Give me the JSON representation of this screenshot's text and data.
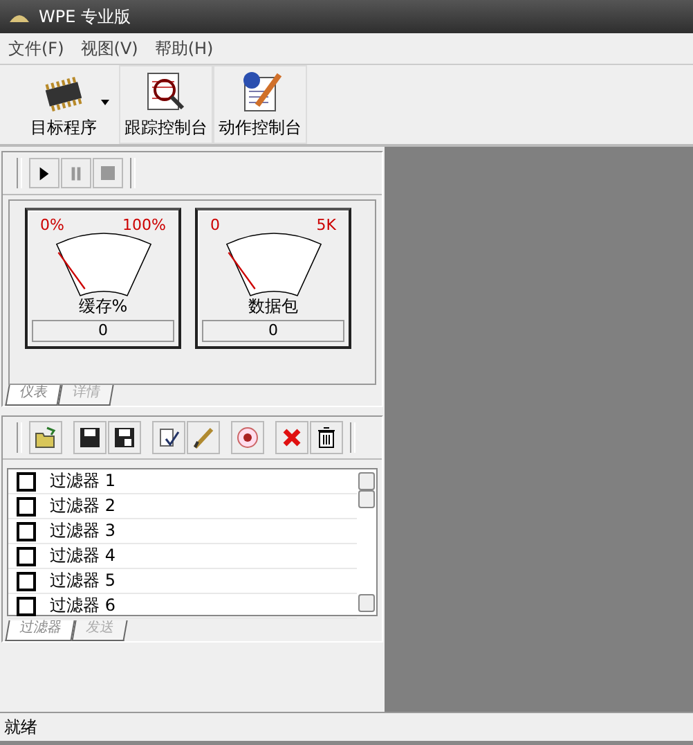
{
  "window": {
    "title": "WPE 专业版"
  },
  "menu": [
    "文件(F)",
    "视图(V)",
    "帮助(H)"
  ],
  "toolbar": [
    {
      "kind": "chip",
      "label": "目标程序",
      "dropdown": true
    },
    {
      "kind": "magnifier",
      "label": "跟踪控制台",
      "dropdown": false
    },
    {
      "kind": "pencil",
      "label": "动作控制台",
      "dropdown": false
    }
  ],
  "player": [
    {
      "kind": "play",
      "disabled": false
    },
    {
      "kind": "pause",
      "disabled": true
    },
    {
      "kind": "stop",
      "disabled": true
    }
  ],
  "gauges": [
    {
      "min": "0%",
      "max": "100%",
      "label": "缓存%",
      "value": "0",
      "level": 0
    },
    {
      "min": "0",
      "max": "5K",
      "label": "数据包",
      "value": "0",
      "level": 0
    }
  ],
  "gauge_tabs": [
    {
      "label": "仪表",
      "selected": true
    },
    {
      "label": "详情",
      "selected": false
    }
  ],
  "filter_tools": [
    {
      "kind": "open"
    },
    {
      "kind": "save"
    },
    {
      "kind": "save-as"
    },
    {
      "kind": "check"
    },
    {
      "kind": "pen"
    },
    {
      "kind": "on"
    },
    {
      "kind": "delete"
    },
    {
      "kind": "trash"
    }
  ],
  "filters": [
    {
      "label": "过滤器 1",
      "checked": false
    },
    {
      "label": "过滤器 2",
      "checked": false
    },
    {
      "label": "过滤器 3",
      "checked": false
    },
    {
      "label": "过滤器 4",
      "checked": false
    },
    {
      "label": "过滤器 5",
      "checked": false
    },
    {
      "label": "过滤器 6",
      "checked": false
    }
  ],
  "filter_tabs": [
    {
      "label": "过滤器",
      "selected": true
    },
    {
      "label": "发送",
      "selected": false
    }
  ],
  "status_bar": "就绪"
}
